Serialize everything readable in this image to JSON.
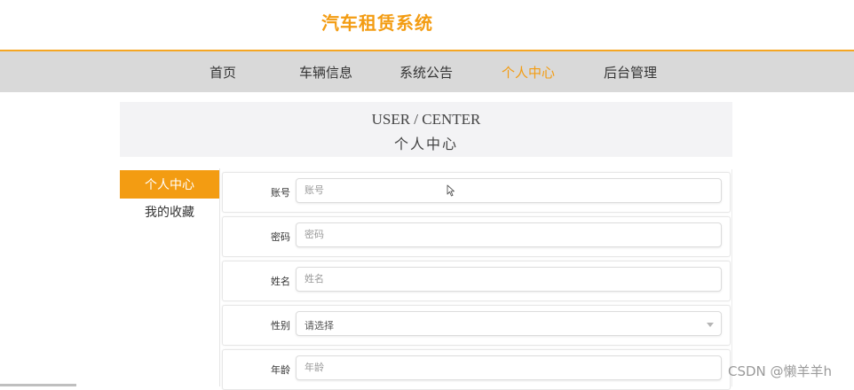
{
  "header": {
    "title": "汽车租赁系统"
  },
  "nav": {
    "items": [
      {
        "label": "首页",
        "active": false
      },
      {
        "label": "车辆信息",
        "active": false
      },
      {
        "label": "系统公告",
        "active": false
      },
      {
        "label": "个人中心",
        "active": true
      },
      {
        "label": "后台管理",
        "active": false
      }
    ],
    "accent_color": "#f39c12",
    "background_color": "#d9d9d9"
  },
  "banner": {
    "title_en": "USER / CENTER",
    "title_cn": "个人中心"
  },
  "sidebar": {
    "items": [
      {
        "label": "个人中心",
        "active": true
      },
      {
        "label": "我的收藏",
        "active": false
      }
    ]
  },
  "form": {
    "fields": [
      {
        "label": "账号",
        "placeholder": "账号",
        "value": ""
      },
      {
        "label": "密码",
        "placeholder": "密码",
        "value": ""
      },
      {
        "label": "姓名",
        "placeholder": "姓名",
        "value": ""
      },
      {
        "label": "性别",
        "selected": "请选择"
      },
      {
        "label": "年龄",
        "placeholder": "年龄",
        "value": ""
      }
    ]
  },
  "watermark": "CSDN @懒羊羊h",
  "icons": {
    "cursor": "mouse-pointer-icon",
    "dropdown": "chevron-down-icon"
  }
}
